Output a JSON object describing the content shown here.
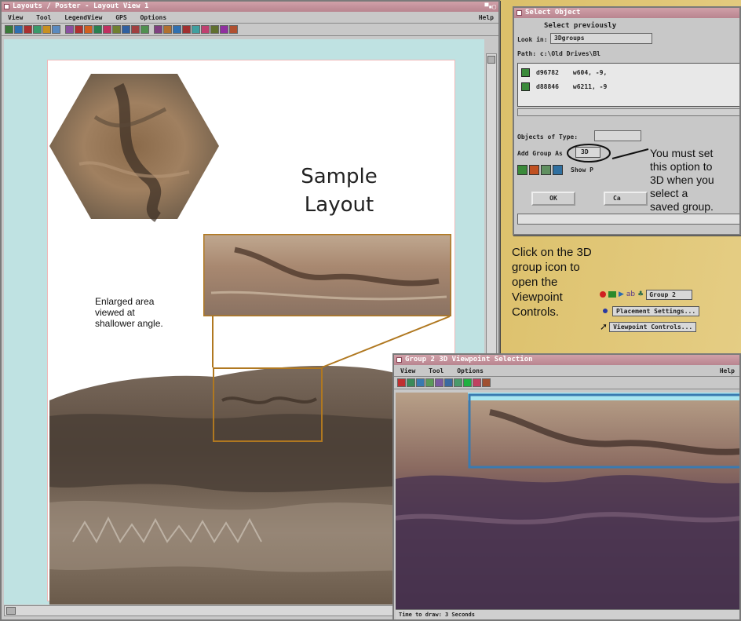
{
  "layout_window": {
    "title": "Layouts / Poster - Layout View 1",
    "controls": "▀▪▢",
    "menu": [
      "View",
      "Tool",
      "LegendView",
      "GPS",
      "Options"
    ],
    "help": "Help",
    "toolbar_colors": [
      "#3a7a3a",
      "#2f6fb0",
      "#aa3030",
      "#3a9a6a",
      "#c89020",
      "#5a8ac0",
      "#8a50a0",
      "#b03030",
      "#d06020",
      "#2a8050",
      "#c03060",
      "#708030",
      "#3060a0",
      "#a04040",
      "#509050",
      "#804080",
      "#b07030",
      "#3070b0",
      "#a03030",
      "#40a0a0",
      "#c04070",
      "#607030",
      "#9030a0",
      "#b05030"
    ],
    "layout_title": "Sample\nLayout",
    "annotation": "Enlarged area\nviewed at\nshallower angle."
  },
  "select_object_window": {
    "title": "Select Object",
    "prompt": "Select previously",
    "look_in_label": "Look in:",
    "look_in_value": "3Dgroups",
    "path": "Path: c:\\Old Drives\\Bl",
    "objects": [
      {
        "name": "d96782",
        "coords": "w604, -9,"
      },
      {
        "name": "d88846",
        "coords": "w6211, -9"
      }
    ],
    "objects_of_type_label": "Objects of Type:",
    "add_group_label": "Add Group As",
    "add_group_value": "3D",
    "show_label": "Show P",
    "ok_label": "OK",
    "cancel_label": "Ca"
  },
  "callouts": {
    "set_3d": "You must set\nthis option to\n3D when you\nselect a\nsaved group.",
    "click_icon": "Click on the 3D\ngroup icon to\nopen the\nViewpoint\nControls."
  },
  "group_menu": {
    "group_name": "Group 2",
    "items": [
      "Placement Settings...",
      "Viewpoint Controls..."
    ]
  },
  "viewpoint_window": {
    "title": "Group 2 3D Viewpoint Selection",
    "menu": [
      "View",
      "Tool",
      "Options"
    ],
    "help": "Help",
    "status": "Time to draw: 3 Seconds"
  },
  "colors": {
    "background": "#e6cf88",
    "window_gray": "#c8c8c8",
    "titlebar": "#b98590",
    "frame_brown": "#b07820",
    "selection_blue": "#3a7ab0",
    "cyan_bg": "#bfe2e2"
  }
}
